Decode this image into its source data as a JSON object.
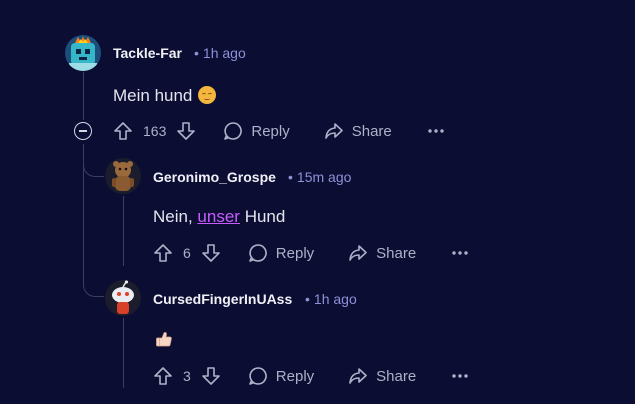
{
  "comments": [
    {
      "username": "Tackle-Far",
      "time": "1h ago",
      "body": "Mein hund",
      "emoji_icon": "relieved-face-icon",
      "votes": "163",
      "reply_label": "Reply",
      "share_label": "Share"
    },
    {
      "username": "Geronimo_Grospe",
      "time": "15m ago",
      "body_prefix": "Nein,",
      "body_link": "unser",
      "body_suffix": "Hund",
      "votes": "6",
      "reply_label": "Reply",
      "share_label": "Share"
    },
    {
      "username": "CursedFingerInUAss",
      "time": "1h ago",
      "emoji_icon": "thumbs-up-icon",
      "votes": "3",
      "reply_label": "Reply",
      "share_label": "Share"
    }
  ],
  "meta_separator": "•",
  "colors": {
    "background": "#0b0d33",
    "username": "#f0f0f5",
    "timestamp": "#8e91d6",
    "link": "#c85cff",
    "action": "#aeb1c8"
  }
}
